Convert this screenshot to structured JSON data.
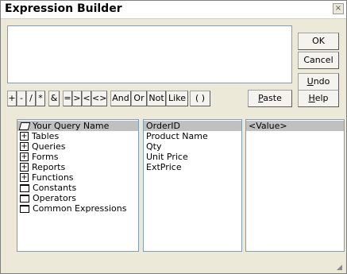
{
  "window": {
    "title": "Expression Builder",
    "close_glyph": "×"
  },
  "buttons": {
    "ok": "OK",
    "cancel": "Cancel",
    "undo_u": "U",
    "undo_rest": "ndo",
    "help_u": "H",
    "help_rest": "elp",
    "paste_u": "P",
    "paste_rest": "aste"
  },
  "operators": [
    "+",
    "-",
    "/",
    "*",
    "&",
    "=",
    ">",
    "<",
    "<>",
    "And",
    "Or",
    "Not",
    "Like",
    "( )"
  ],
  "lists": {
    "left": [
      {
        "label": "Your Query Name",
        "icon": "open-folder-icon",
        "selected": true
      },
      {
        "label": "Tables",
        "icon": "plus-expand-icon",
        "selected": false
      },
      {
        "label": "Queries",
        "icon": "plus-expand-icon",
        "selected": false
      },
      {
        "label": "Forms",
        "icon": "plus-expand-icon",
        "selected": false
      },
      {
        "label": "Reports",
        "icon": "plus-expand-icon",
        "selected": false
      },
      {
        "label": "Functions",
        "icon": "plus-expand-icon",
        "selected": false
      },
      {
        "label": "Constants",
        "icon": "folder-icon",
        "selected": false
      },
      {
        "label": "Operators",
        "icon": "folder-icon",
        "selected": false
      },
      {
        "label": "Common Expressions",
        "icon": "folder-icon",
        "selected": false
      }
    ],
    "middle": [
      {
        "label": "OrderID",
        "selected": true
      },
      {
        "label": "Product Name",
        "selected": false
      },
      {
        "label": "Qty",
        "selected": false
      },
      {
        "label": "Unit Price",
        "selected": false
      },
      {
        "label": "ExtPrice",
        "selected": false
      }
    ],
    "right": [
      {
        "label": "<Value>",
        "selected": true
      }
    ]
  }
}
